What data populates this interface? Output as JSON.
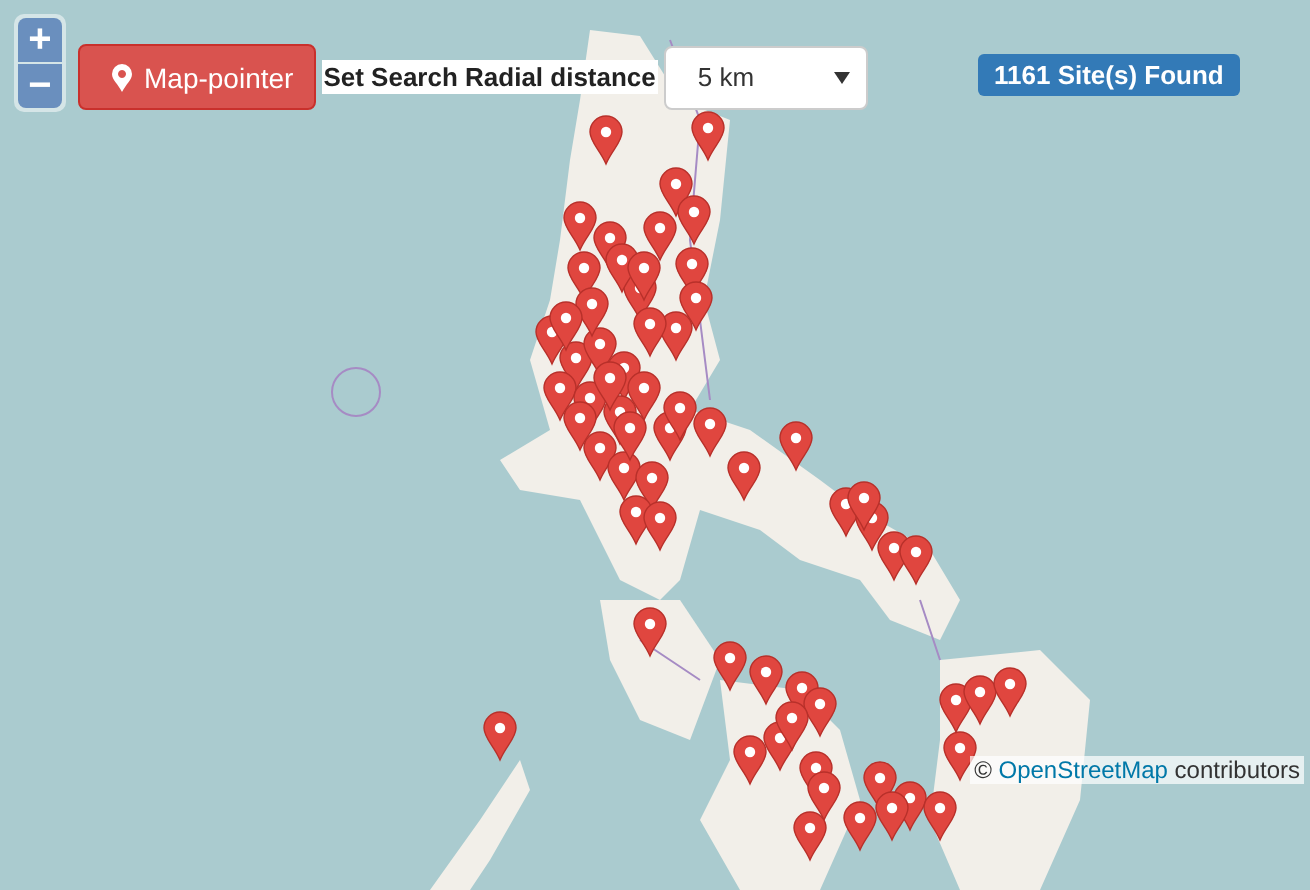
{
  "zoom_control": {
    "zoom_in": "+",
    "zoom_out": "−"
  },
  "toolbar": {
    "pointer_button": "Map-pointer",
    "radius_label": "Set Search Radial distance",
    "radius_select": {
      "value": "5 km"
    }
  },
  "result_badge": "1161 Site(s) Found",
  "attribution": {
    "prefix": "©",
    "link": "OpenStreetMap",
    "suffix": "contributors"
  }
}
